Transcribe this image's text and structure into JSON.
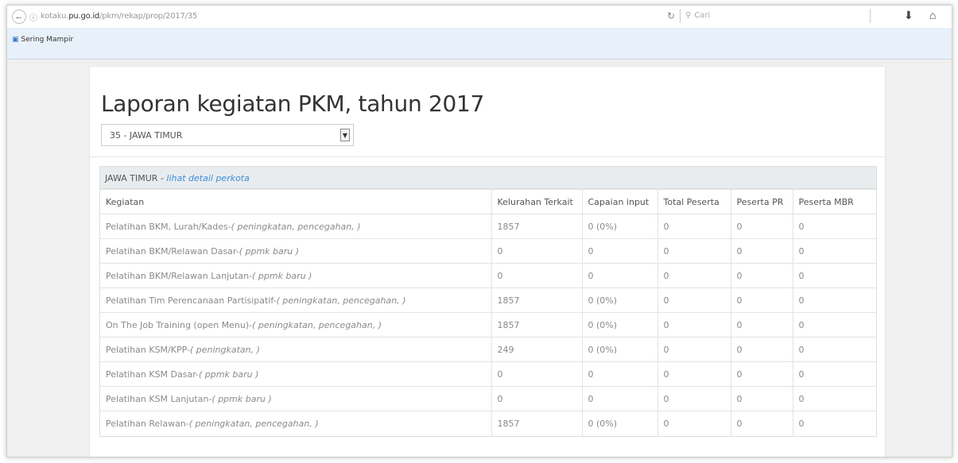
{
  "browser": {
    "url_prefix": "kotaku.",
    "url_host": "pu.go.id",
    "url_path": "/pkm/rekap/prop/2017/35",
    "search_placeholder": "Cari",
    "bookmark_label": "Sering Mampir"
  },
  "page": {
    "title": "Laporan kegiatan PKM, tahun 2017",
    "province_selected": "35 - JAWA TIMUR"
  },
  "panel": {
    "region": "JAWA TIMUR",
    "separator": " - ",
    "detail_link": "lihat detail perkota"
  },
  "table": {
    "headers": [
      "Kegiatan",
      "Kelurahan Terkait",
      "Capaian input",
      "Total Peserta",
      "Peserta PR",
      "Peserta MBR"
    ],
    "rows": [
      {
        "kegiatan": "Pelatihan BKM, Lurah/Kades-",
        "note": "( peningkatan, pencegahan, )",
        "kelurahan": "1857",
        "capaian": "0 (0%)",
        "total": "0",
        "pr": "0",
        "mbr": "0"
      },
      {
        "kegiatan": "Pelatihan BKM/Relawan Dasar-",
        "note": "( ppmk baru )",
        "kelurahan": "0",
        "capaian": "0",
        "total": "0",
        "pr": "0",
        "mbr": "0"
      },
      {
        "kegiatan": "Pelatihan BKM/Relawan Lanjutan-",
        "note": "( ppmk baru )",
        "kelurahan": "0",
        "capaian": "0",
        "total": "0",
        "pr": "0",
        "mbr": "0"
      },
      {
        "kegiatan": "Pelatihan Tim Perencanaan Partisipatif-",
        "note": "( peningkatan, pencegahan, )",
        "kelurahan": "1857",
        "capaian": "0 (0%)",
        "total": "0",
        "pr": "0",
        "mbr": "0"
      },
      {
        "kegiatan": "On The Job Training (open Menu)-",
        "note": "( peningkatan, pencegahan, )",
        "kelurahan": "1857",
        "capaian": "0 (0%)",
        "total": "0",
        "pr": "0",
        "mbr": "0"
      },
      {
        "kegiatan": "Pelatihan KSM/KPP-",
        "note": "( peningkatan, )",
        "kelurahan": "249",
        "capaian": "0 (0%)",
        "total": "0",
        "pr": "0",
        "mbr": "0"
      },
      {
        "kegiatan": "Pelatihan KSM Dasar-",
        "note": "( ppmk baru )",
        "kelurahan": "0",
        "capaian": "0",
        "total": "0",
        "pr": "0",
        "mbr": "0"
      },
      {
        "kegiatan": "Pelatihan KSM Lanjutan-",
        "note": "( ppmk baru )",
        "kelurahan": "0",
        "capaian": "0",
        "total": "0",
        "pr": "0",
        "mbr": "0"
      },
      {
        "kegiatan": "Pelatihan Relawan-",
        "note": "( peningkatan, pencegahan, )",
        "kelurahan": "1857",
        "capaian": "0 (0%)",
        "total": "0",
        "pr": "0",
        "mbr": "0"
      }
    ]
  },
  "colors": {
    "link": "#3a8ed8",
    "heading_bg": "#e9ecef",
    "bookmark_bar": "#e8f0f9"
  }
}
